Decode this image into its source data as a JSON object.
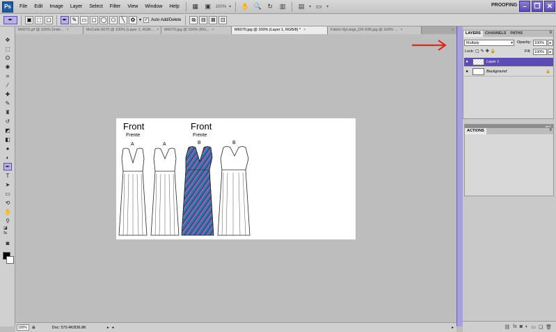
{
  "app": {
    "logo": "Ps"
  },
  "menu": [
    "File",
    "Edit",
    "Image",
    "Layer",
    "Select",
    "Filter",
    "View",
    "Window",
    "Help"
  ],
  "menubar": {
    "zoom": "100%",
    "workspace": "PROOFING"
  },
  "options": {
    "auto_add_delete": "Auto Add/Delete"
  },
  "tabs": [
    {
      "label": "M6070.gif @ 100% (Inde...",
      "active": false
    },
    {
      "label": "McCalls 6070 @ 100% (Layer 1, RGB...",
      "active": false
    },
    {
      "label": "M6070.jpg @ 100% (RG...",
      "active": false
    },
    {
      "label": "M6070.jpg @ 100% (Layer 1, RGB/8) *",
      "active": true
    },
    {
      "label": "Fabric-ItyLarge_DS-936.jpg @ 100% ...",
      "active": false
    }
  ],
  "canvas": {
    "front_labels": [
      "Front",
      "Front"
    ],
    "frente_labels": [
      "Frente",
      "Frente"
    ],
    "view_letters": [
      "A",
      "A",
      "B",
      "B"
    ]
  },
  "status": {
    "zoom": "100%",
    "doc": "Doc: 570.4K/836.8K"
  },
  "layers_panel": {
    "tabs": [
      "LAYERS",
      "CHANNELS",
      "PATHS"
    ],
    "blend_mode": "Multiply",
    "opacity_label": "Opacity:",
    "opacity": "100%",
    "lock_label": "Lock:",
    "fill_label": "Fill:",
    "fill": "100%",
    "layers": [
      {
        "name": "Layer 1",
        "selected": true
      },
      {
        "name": "Background",
        "selected": false
      }
    ]
  },
  "actions_panel": {
    "title": "ACTIONS"
  },
  "colors": {
    "accent": "#5a4bb5",
    "annotation": "#e8231f"
  }
}
